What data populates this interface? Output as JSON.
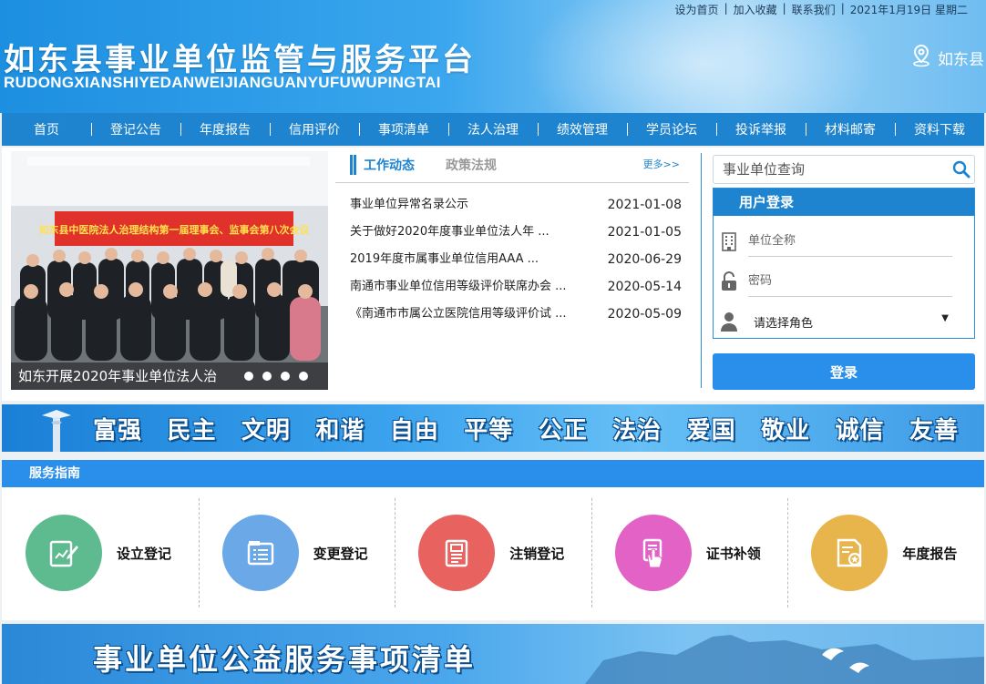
{
  "topbar": {
    "set_home": "设为首页",
    "add_favorite": "加入收藏",
    "contact": "联系我们",
    "date": "2021年1月19日 星期二"
  },
  "header": {
    "title": "如东县事业单位监管与服务平台",
    "subtitle": "RUDONGXIANSHIYEDANWEIJIANGUANYUFUWUPINGTAI",
    "location": "如东县",
    "location_icon": "location-pin-icon"
  },
  "nav": {
    "items": [
      "首页",
      "登记公告",
      "年度报告",
      "信用评价",
      "事项清单",
      "法人治理",
      "绩效管理",
      "学员论坛",
      "投诉举报",
      "材料邮寄",
      "资料下载"
    ]
  },
  "slideshow": {
    "banner_text": "如东县中医院法人治理结构第一届理事会、监事会第八次会议",
    "caption": "如东开展2020年事业单位法人治",
    "dot_count": 4
  },
  "news": {
    "tab_active": "工作动态",
    "tab_inactive": "政策法规",
    "more": "更多>>",
    "items": [
      {
        "title": "事业单位异常名录公示",
        "date": "2021-01-08"
      },
      {
        "title": "关于做好2020年度事业单位法人年 ...",
        "date": "2021-01-05"
      },
      {
        "title": "2019年度市属事业单位信用AAA ...",
        "date": "2020-06-29"
      },
      {
        "title": "南通市事业单位信用等级评价联席办会 ...",
        "date": "2020-05-14"
      },
      {
        "title": "《南通市市属公立医院信用等级评价试 ...",
        "date": "2020-05-09"
      }
    ]
  },
  "search": {
    "placeholder": "事业单位查询",
    "icon": "search-icon"
  },
  "login": {
    "title": "用户登录",
    "unit_placeholder": "单位全称",
    "password_placeholder": "密码",
    "role_label": "请选择角色",
    "role_arrow": "▼",
    "button": "登录"
  },
  "values": {
    "words": [
      "富强",
      "民主",
      "文明",
      "和谐",
      "自由",
      "平等",
      "公正",
      "法治",
      "爱国",
      "敬业",
      "诚信",
      "友善"
    ]
  },
  "guide": {
    "title": "服务指南",
    "items": [
      {
        "label": "设立登记",
        "color": "#5dbb8f",
        "icon": "edit-document-icon"
      },
      {
        "label": "变更登记",
        "color": "#6aa8e8",
        "icon": "list-document-icon"
      },
      {
        "label": "注销登记",
        "color": "#e8625f",
        "icon": "cancel-document-icon"
      },
      {
        "label": "证书补领",
        "color": "#e263c5",
        "icon": "certificate-hand-icon"
      },
      {
        "label": "年度报告",
        "color": "#e7b54c",
        "icon": "annual-report-icon"
      }
    ]
  },
  "bottom_banner": {
    "title": "事业单位公益服务事项清单"
  },
  "colors": {
    "primary": "#1e84cf",
    "button": "#2a8fea"
  }
}
